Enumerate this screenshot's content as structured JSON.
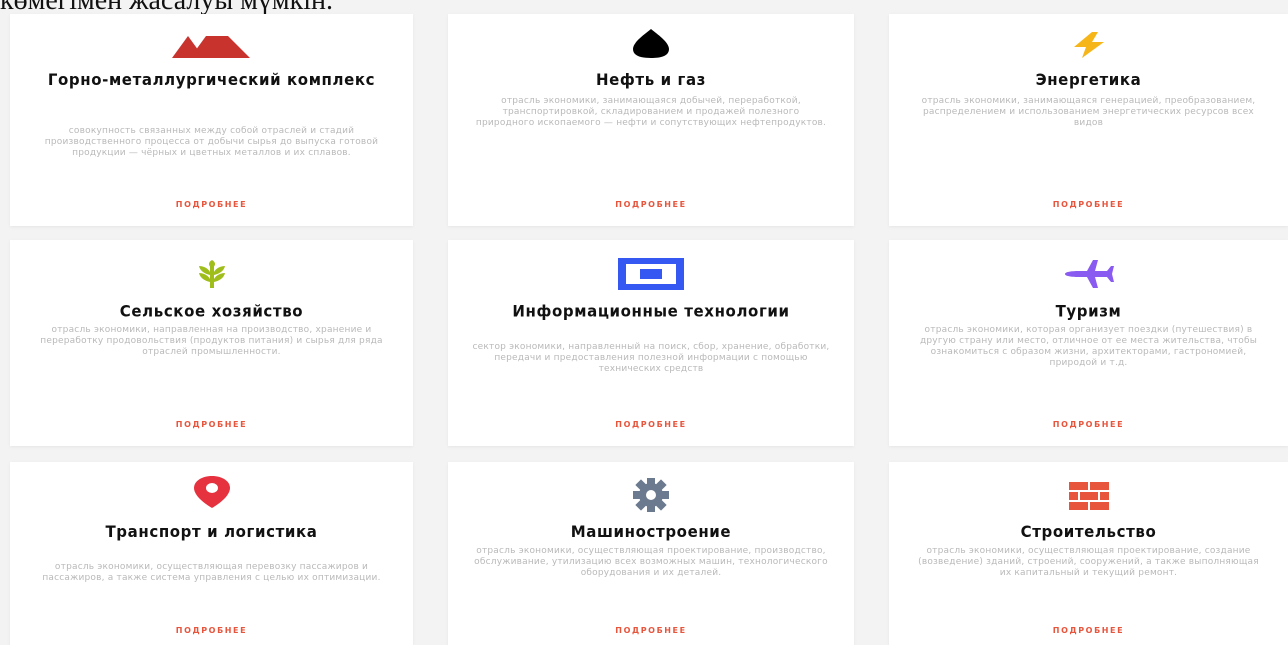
{
  "top_text": "көмегімен жасалуы мүмкін.",
  "more_label": "ПОДРОБНЕЕ",
  "colors": {
    "accent": "#e8553d",
    "mining": "#c9332e",
    "oil": "#000000",
    "energy": "#f6b619",
    "agro": "#9fbd1b",
    "it": "#3557f2",
    "tourism": "#8a5bf0",
    "transport": "#e6323e",
    "machinery": "#6b7a8f",
    "construction": "#e8553d"
  },
  "cards": [
    {
      "title": "Горно-металлургический комплекс",
      "icon": "mountains-icon",
      "description": "совокупность связанных между собой отраслей и стадий производственного процесса от добычи сырья до выпуска готовой продукции — чёрных и цветных металлов и их сплавов."
    },
    {
      "title": "Нефть и газ",
      "icon": "oil-drop-icon",
      "description": "отрасль экономики, занимающаяся добычей, переработкой, транспортировкой, складированием и продажей полезного природного ископаемого — нефти и сопутствующих нефтепродуктов."
    },
    {
      "title": "Энергетика",
      "icon": "lightning-icon",
      "description": "отрасль экономики, занимающаяся генерацией, преобразованием, распределением и использованием энергетических ресурсов всех видов"
    },
    {
      "title": "Сельское хозяйство",
      "icon": "wheat-icon",
      "description": "отрасль экономики, направленная на производство, хранение и переработку продовольствия (продуктов питания) и сырья для ряда отраслей промышленности."
    },
    {
      "title": "Информационные технологии",
      "icon": "monitor-icon",
      "description": "сектор экономики, направленный на поиск, сбор, хранение, обработки, передачи и предоставления полезной информации с помощью технических средств"
    },
    {
      "title": "Туризм",
      "icon": "airplane-icon",
      "description": "отрасль экономики, которая организует поездки (путешествия) в другую страну или место, отличное от ее места жительства, чтобы ознакомиться с образом жизни, архитекторами, гастрономией, природой и т.д."
    },
    {
      "title": "Транспорт и логистика",
      "icon": "map-pin-icon",
      "description": "отрасль экономики, осуществляющая перевозку пассажиров и пассажиров, а также система управления с целью их оптимизации."
    },
    {
      "title": "Машиностроение",
      "icon": "gear-icon",
      "description": "отрасль экономики, осуществляющая проектирование, производство, обслуживание, утилизацию всех возможных машин, технологического оборудования и их деталей."
    },
    {
      "title": "Строительство",
      "icon": "bricks-icon",
      "description": "отрасль экономики, осуществляющая проектирование, создание (возведение) зданий, строений, сооружений, а также выполняющая их капитальный и текущий ремонт."
    }
  ]
}
